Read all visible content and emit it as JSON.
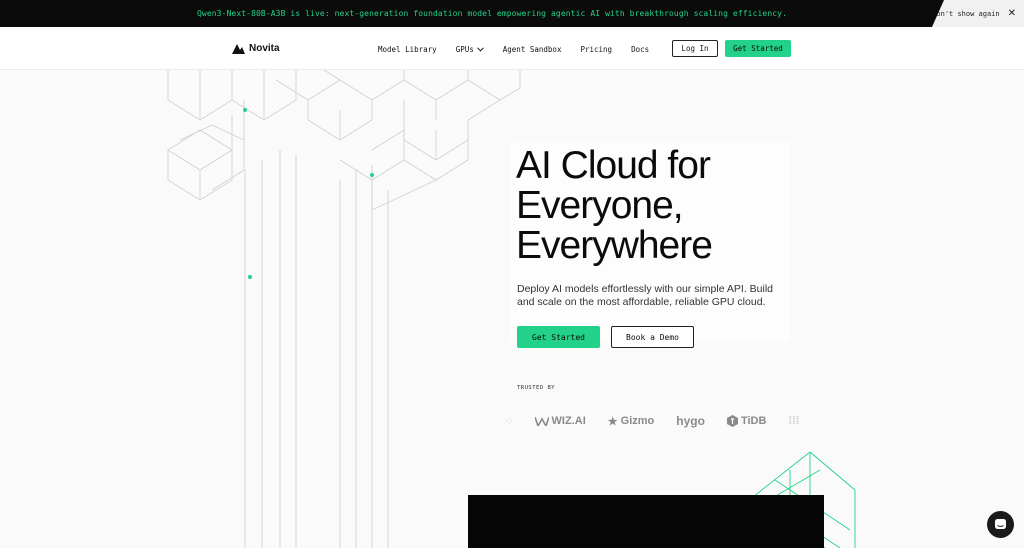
{
  "announcement": {
    "text": "Qwen3-Next-80B-A3B is live: next-generation foundation model empowering agentic AI with breakthrough scaling efficiency.",
    "dismiss_label": "Don't show again",
    "close_icon": "close-icon"
  },
  "nav": {
    "brand": "Novita",
    "links": [
      "Model Library",
      "GPUs",
      "Agent Sandbox",
      "Pricing",
      "Docs"
    ],
    "login_label": "Log In",
    "cta_label": "Get Started"
  },
  "hero": {
    "headline_lines": [
      "AI Cloud for",
      "Everyone,",
      "Everywhere"
    ],
    "subtitle": "Deploy AI models effortlessly with our simple API. Build and scale on the most affordable, reliable GPU cloud.",
    "primary_cta": "Get Started",
    "secondary_cta": "Book a Demo",
    "trusted_label": "TRUSTED BY",
    "trusted_logos": [
      "WIZ.AI",
      "Gizmo",
      "hygo",
      "TiDB"
    ]
  },
  "colors": {
    "accent": "#23d28a",
    "dark": "#0b0b0b"
  },
  "icons": {
    "chat": "chat-bubble-icon",
    "chevron": "chevron-down-icon"
  }
}
